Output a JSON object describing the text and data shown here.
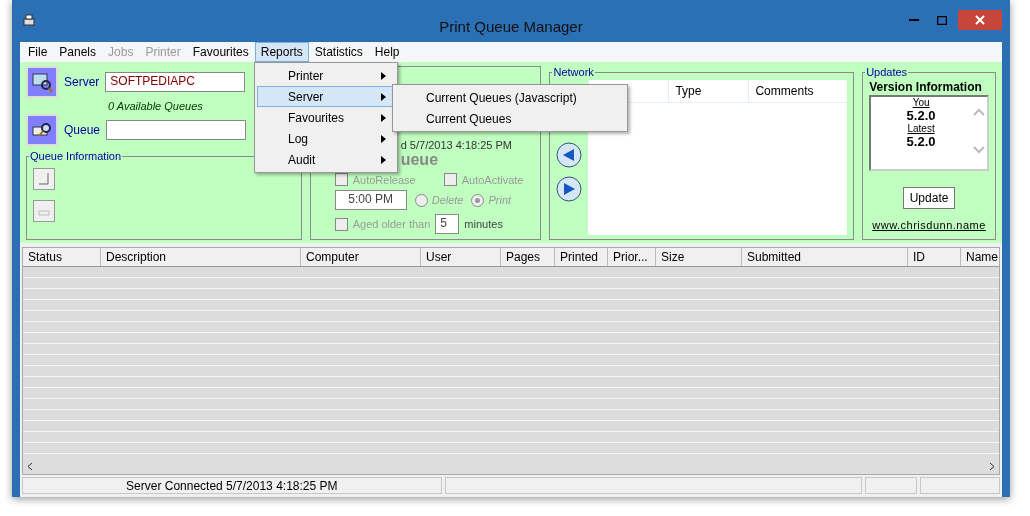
{
  "window": {
    "title": "Print Queue Manager"
  },
  "menu_bar": [
    {
      "label": "File",
      "disabled": false,
      "selected": false
    },
    {
      "label": "Panels",
      "disabled": false,
      "selected": false
    },
    {
      "label": "Jobs",
      "disabled": true,
      "selected": false
    },
    {
      "label": "Printer",
      "disabled": true,
      "selected": false
    },
    {
      "label": "Favourites",
      "disabled": false,
      "selected": false
    },
    {
      "label": "Reports",
      "disabled": false,
      "selected": true
    },
    {
      "label": "Statistics",
      "disabled": false,
      "selected": false
    },
    {
      "label": "Help",
      "disabled": false,
      "selected": false
    }
  ],
  "open_menu": {
    "items": [
      {
        "label": "Printer",
        "selected": false
      },
      {
        "label": "Server",
        "selected": true
      },
      {
        "label": "Favourites",
        "selected": false
      },
      {
        "label": "Log",
        "selected": false
      },
      {
        "label": "Audit",
        "selected": false
      }
    ],
    "submenu": [
      {
        "label": "Current Queues (Javascript)"
      },
      {
        "label": "Current Queues"
      }
    ]
  },
  "server_panel": {
    "server_label": "Server",
    "server_value": "SOFTPEDIAPC",
    "available_queues": "0 Available Queues",
    "queue_label": "Queue",
    "queue_info_title": "Queue Information"
  },
  "middle_panel": {
    "date_fragment": "d 5/7/2013 4:18:25 PM",
    "heading_fragment": "ueue",
    "checkboxes": [
      {
        "label": "AutoRelease",
        "checked": false
      },
      {
        "label": "AutoActivate",
        "checked": false
      }
    ],
    "time": "5:00 PM",
    "radios": [
      {
        "label": "Delete",
        "selected": false
      },
      {
        "label": "Print",
        "selected": true
      }
    ],
    "aged": {
      "label": "Aged older than",
      "checked": false,
      "value": "5",
      "unit": "minutes"
    }
  },
  "network_panel": {
    "title": "Network",
    "columns": [
      "Type",
      "Comments"
    ]
  },
  "updates_panel": {
    "title": "Updates",
    "heading": "Version Information",
    "you_label": "You",
    "you_version": "5.2.0",
    "latest_label": "Latest",
    "latest_version": "5.2.0",
    "button": "Update",
    "link": "www.chrisdunn.name"
  },
  "table": {
    "columns": [
      "Status",
      "Description",
      "Computer",
      "User",
      "Pages",
      "Printed",
      "Prior...",
      "Size",
      "Submitted",
      "ID",
      "Name"
    ]
  },
  "status_bar": [
    "Server Connected 5/7/2013 4:18:25 PM"
  ]
}
